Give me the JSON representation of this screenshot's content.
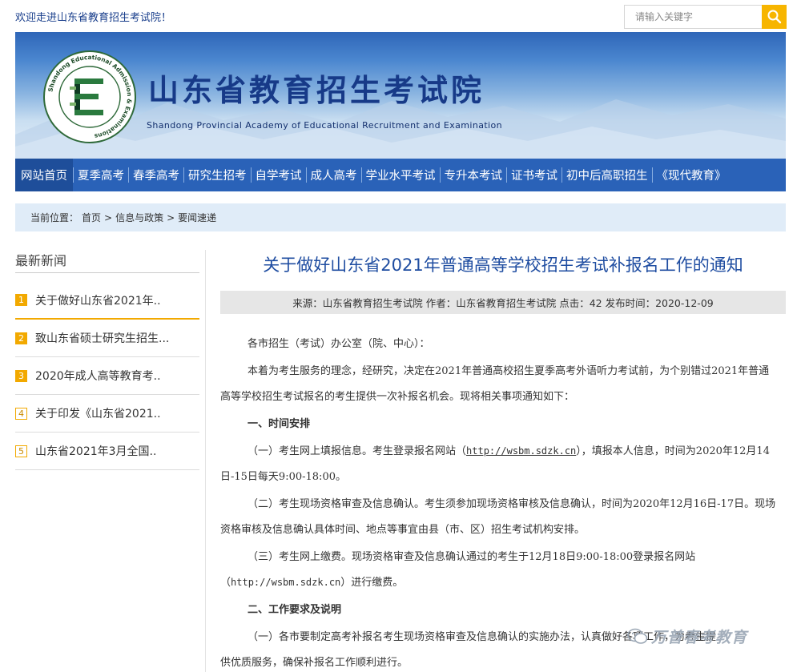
{
  "header": {
    "welcome": "欢迎走进山东省教育招生考试院！",
    "search_placeholder": "请输入关键字"
  },
  "banner": {
    "title": "山东省教育招生考试院",
    "subtitle": "Shandong Provincial Academy of Educational Recruitment and Examination",
    "logo_ring_text": "Shandong Educational Admission & Examinations",
    "logo_cn": "山东省教育招生考试院"
  },
  "nav": {
    "items": [
      "网站首页",
      "夏季高考",
      "春季高考",
      "研究生招考",
      "自学考试",
      "成人高考",
      "学业水平考试",
      "专升本考试",
      "证书考试",
      "初中后高职招生",
      "《现代教育》"
    ],
    "active": "网站首页"
  },
  "breadcrumb": {
    "prefix": "当前位置：",
    "items": [
      "首页",
      "信息与政策",
      "要闻速递"
    ],
    "sep": ">"
  },
  "sidebar": {
    "title": "最新新闻",
    "items": [
      {
        "num": "1",
        "label": "关于做好山东省2021年.."
      },
      {
        "num": "2",
        "label": "致山东省硕士研究生招生..."
      },
      {
        "num": "3",
        "label": "2020年成人高等教育考.."
      },
      {
        "num": "4",
        "label": "关于印发《山东省2021.."
      },
      {
        "num": "5",
        "label": "山东省2021年3月全国.."
      }
    ]
  },
  "article": {
    "title": "关于做好山东省2021年普通高等学校招生考试补报名工作的通知",
    "meta": "来源：山东省教育招生考试院 作者：山东省教育招生考试院 点击：42 发布时间：2020-12-09",
    "salutation": "各市招生（考试）办公室（院、中心）：",
    "p1a": "本着为考生服务的理念，经研究，决定在2021年普通高校招生夏季高考外语听力考试前，为个别错过2021年普通",
    "p1b": "高等学校招生考试报名的考生提供一次补报名机会。现将相关事项通知如下：",
    "h1": "一、时间安排",
    "s1a_pre": "（一）考生网上填报信息。考生登录报名网站（",
    "s1a_url": "http://wsbm.sdzk.cn",
    "s1a_post": "），填报本人信息，时间为2020年12月14",
    "s1b": "日-15日每天9:00-18:00。",
    "s2a": "（二）考生现场资格审查及信息确认。考生须参加现场资格审核及信息确认，时间为2020年12月16日-17日。现场",
    "s2b": "资格审核及信息确认具体时间、地点等事宜由县（市、区）招生考试机构安排。",
    "s3a": "（三）考生网上缴费。现场资格审查及信息确认通过的考生于12月18日9:00-18:00登录报名网站",
    "s3b_pre": "（",
    "s3b_url": "http://wsbm.sdzk.cn",
    "s3b_post": "）进行缴费。",
    "h2": "二、工作要求及说明",
    "t1a": "（一）各市要制定高考补报名考生现场资格审查及信息确认的实施办法，认真做好各项工作，为考生提",
    "t1b": "供优质服务，确保补报名工作顺利进行。"
  },
  "watermark": {
    "text": "万普春考教育"
  }
}
